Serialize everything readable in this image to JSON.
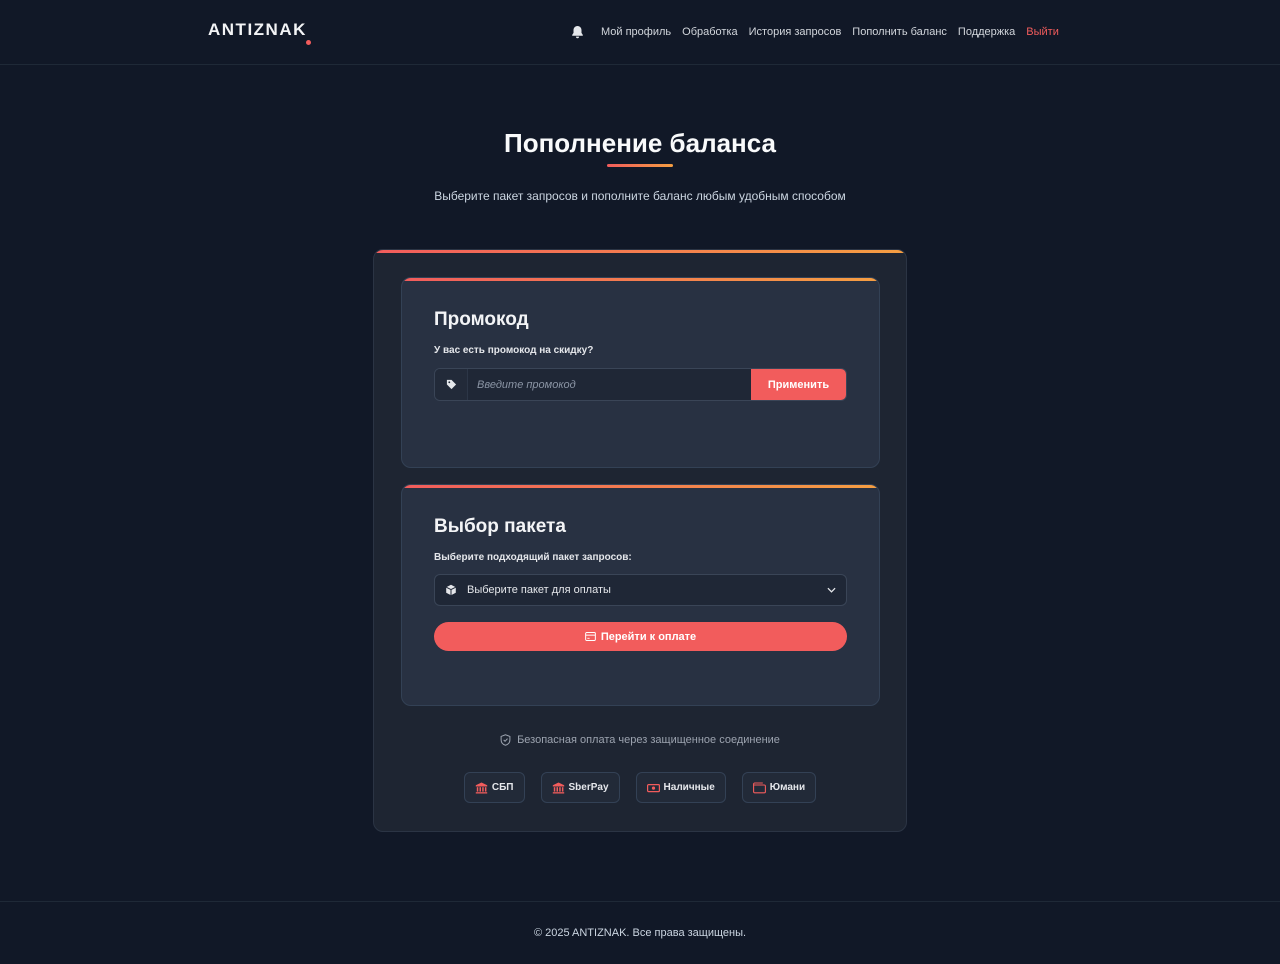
{
  "header": {
    "logo": "ANTIZNAK",
    "nav": [
      {
        "label": "Мой профиль"
      },
      {
        "label": "Обработка"
      },
      {
        "label": "История запросов"
      },
      {
        "label": "Пополнить баланс"
      },
      {
        "label": "Поддержка"
      },
      {
        "label": "Выйти"
      }
    ]
  },
  "page": {
    "title": "Пополнение баланса",
    "subtitle": "Выберите пакет запросов и пополните баланс любым удобным способом"
  },
  "promo": {
    "title": "Промокод",
    "label": "У вас есть промокод на скидку?",
    "placeholder": "Введите промокод",
    "apply_label": "Применить"
  },
  "package": {
    "title": "Выбор пакета",
    "label": "Выберите подходящий пакет запросов:",
    "select_text": "Выберите пакет для оплаты",
    "pay_label": "Перейти к оплате"
  },
  "secure_note": "Безопасная оплата через защищенное соединение",
  "payment_methods": [
    {
      "label": "СБП",
      "icon": "bank-icon"
    },
    {
      "label": "SberPay",
      "icon": "bank-icon"
    },
    {
      "label": "Наличные",
      "icon": "cash-icon"
    },
    {
      "label": "Юмани",
      "icon": "wallet-icon"
    }
  ],
  "footer": {
    "text": "© 2025 ANTIZNAK. Все права защищены."
  },
  "colors": {
    "accent": "#f25c5c",
    "accent_gradient_end": "#f59e42",
    "background": "#111827",
    "card": "#1e2532",
    "inner_card": "#283142"
  }
}
